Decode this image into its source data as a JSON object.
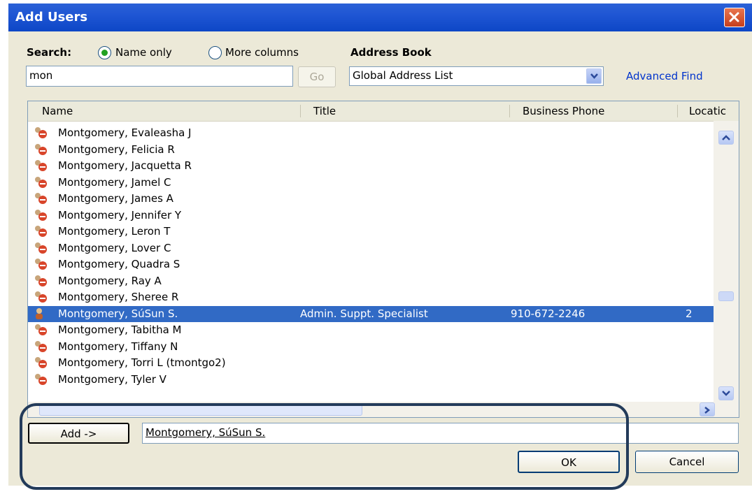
{
  "window": {
    "title": "Add Users"
  },
  "search": {
    "label": "Search:",
    "option_name_only": "Name only",
    "option_more_columns": "More columns",
    "selected": "Name only",
    "query": "mon",
    "go_label": "Go"
  },
  "address_book": {
    "label": "Address Book",
    "selected": "Global Address List",
    "advanced_find": "Advanced Find"
  },
  "columns": [
    "Name",
    "Title",
    "Business Phone",
    "Locatic"
  ],
  "rows": [
    {
      "name": "Montgomery, Evaleasha J",
      "title": "",
      "phone": "",
      "location": ""
    },
    {
      "name": "Montgomery, Felicia R",
      "title": "",
      "phone": "",
      "location": ""
    },
    {
      "name": "Montgomery, Jacquetta R",
      "title": "",
      "phone": "",
      "location": ""
    },
    {
      "name": "Montgomery, Jamel C",
      "title": "",
      "phone": "",
      "location": ""
    },
    {
      "name": "Montgomery, James A",
      "title": "",
      "phone": "",
      "location": ""
    },
    {
      "name": "Montgomery, Jennifer Y",
      "title": "",
      "phone": "",
      "location": ""
    },
    {
      "name": "Montgomery, Leron T",
      "title": "",
      "phone": "",
      "location": ""
    },
    {
      "name": "Montgomery, Lover C",
      "title": "",
      "phone": "",
      "location": ""
    },
    {
      "name": "Montgomery, Quadra S",
      "title": "",
      "phone": "",
      "location": ""
    },
    {
      "name": "Montgomery, Ray A",
      "title": "",
      "phone": "",
      "location": ""
    },
    {
      "name": "Montgomery, Sheree R",
      "title": "",
      "phone": "",
      "location": ""
    },
    {
      "name": "Montgomery, SúSun S.",
      "title": "Admin. Suppt. Specialist",
      "phone": "910-672-2246",
      "location": "2",
      "selected": true
    },
    {
      "name": "Montgomery, Tabitha M",
      "title": "",
      "phone": "",
      "location": ""
    },
    {
      "name": "Montgomery, Tiffany N",
      "title": "",
      "phone": "",
      "location": ""
    },
    {
      "name": "Montgomery, Torri L (tmontgo2)",
      "title": "",
      "phone": "",
      "location": ""
    },
    {
      "name": "Montgomery, Tyler V",
      "title": "",
      "phone": "",
      "location": ""
    }
  ],
  "add": {
    "button_label": "Add ->",
    "added_value": "Montgomery, SúSun S."
  },
  "footer": {
    "ok_label": "OK",
    "cancel_label": "Cancel"
  },
  "colors": {
    "title_bar": "#0d46c6",
    "selection": "#316ac5",
    "dialog_bg": "#ece9d8",
    "annotation": "#233b5a"
  },
  "icons": [
    "close-icon",
    "dropdown-arrow-icon",
    "user-icon",
    "scroll-up-icon",
    "scroll-down-icon",
    "scroll-right-icon"
  ]
}
